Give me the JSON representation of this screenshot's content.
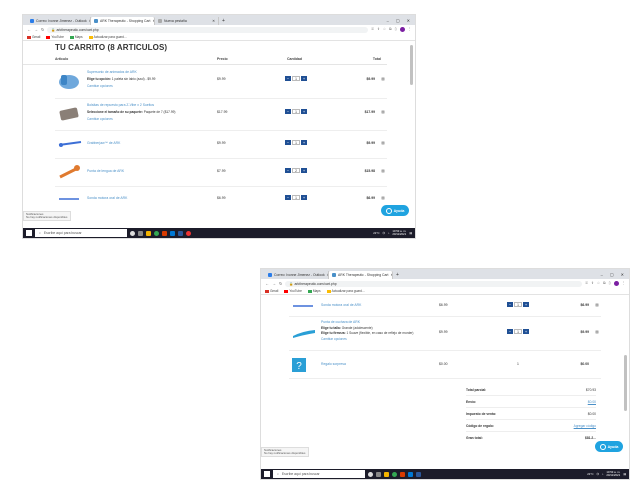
{
  "browser": {
    "tabs": [
      "Correo: Ivonne Jimenez - Outlook",
      "ARK Therapeutic - Shopping Cart",
      "Nueva pestaña"
    ],
    "tabs2": [
      "Correo: Ivonne Jimenez - Outlook",
      "ARK Therapeutic - Shopping Cart"
    ],
    "new_tab": "+",
    "url": "arktherapeutic.com/cart.php",
    "bookmarks": [
      "Gmail",
      "YouTube",
      "Maps",
      "Actualizar para guard..."
    ]
  },
  "cart": {
    "title": "TU CARRITO (8 ARTICULOS)",
    "headers": {
      "item": "Articulo",
      "price": "Precio",
      "qty": "Cantidad",
      "total": "Total"
    },
    "items": [
      {
        "name": "Supersonic de animados de ARK",
        "opt_label": "Elige tu opción:",
        "opt_value": "1 paleta sin labio (azul) - $9.99",
        "link": "Cambiar opciones",
        "price": "$9.99",
        "qty": "1",
        "total": "$9.99"
      },
      {
        "name": "Bolsitas de repuesto para Z-Vibe x 2 Sueltos",
        "opt_label": "Seleccione el tamaño de su paquete:",
        "opt_value": "Paquete de 7 ($17.99)",
        "link": "Cambiar opciones",
        "price": "$17.99",
        "qty": "1",
        "total": "$17.99"
      },
      {
        "name": "Grabberjaw™ de ARK",
        "price": "$9.99",
        "qty": "1",
        "total": "$9.99"
      },
      {
        "name": "Punta de lengua de ARK",
        "price": "$7.99",
        "qty": "2",
        "total": "$15.98"
      },
      {
        "name": "Sonda motora oral de ARK",
        "price": "$6.99",
        "qty": "1",
        "total": "$6.99"
      },
      {
        "name": "Punta de cuchara de ARK",
        "opt_label1": "Elige tu talla:",
        "opt_value1": "Grande (adolescente)",
        "opt_label2": "Elige tu firmeza:",
        "opt_value2": "1 Suave (flexible, en caso de reflejo de morder)",
        "link": "Cambiar opciones",
        "price": "$9.99",
        "qty": "1",
        "total": "$9.99"
      },
      {
        "name": "Regalo sorpresa",
        "price": "$0.00",
        "qty": "1",
        "total": "$0.00"
      }
    ],
    "summary": [
      {
        "label": "Total parcial:",
        "value": "$70.93"
      },
      {
        "label": "Envío:",
        "value": "$0.00"
      },
      {
        "label": "Impuesto de venta:",
        "value": "$0.00"
      },
      {
        "label": "Código de regalo:",
        "value": "Agregar código"
      },
      {
        "label": "Gran total:",
        "value": "$81.2..."
      }
    ]
  },
  "help_button": "Ayuda",
  "toast": {
    "line1": "Notificaciones",
    "line2": "No hay notificaciones disponibles"
  },
  "taskbar": {
    "search_placeholder": "Escribe aquí para buscar",
    "time": "10:53 a. m.",
    "date": "20/11/2021",
    "weather": "21°C"
  },
  "colors": {
    "accent": "#1f4f94",
    "link": "#4a90c8",
    "help": "#1fa3e0"
  }
}
